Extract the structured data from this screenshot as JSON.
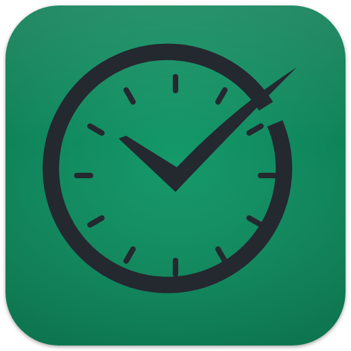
{
  "icon": {
    "name": "clock-check-icon",
    "background_color": "#14996a",
    "background_edge_color": "#0d7a53",
    "glyph_color": "#24282f",
    "clock_tick_count": 12
  }
}
